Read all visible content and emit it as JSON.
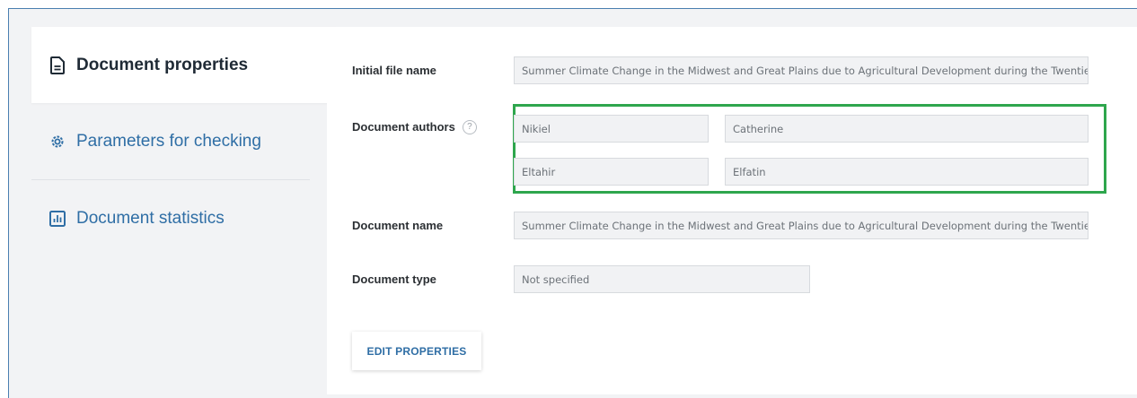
{
  "sidebar": {
    "items": [
      {
        "label": "Document properties",
        "icon": "document-icon",
        "active": true
      },
      {
        "label": "Parameters for checking",
        "icon": "gear-icon",
        "active": false
      },
      {
        "label": "Document statistics",
        "icon": "bar-chart-icon",
        "active": false
      }
    ]
  },
  "properties": {
    "initial_file_name": {
      "label": "Initial file name",
      "value": "Summer Climate Change in the Midwest and Great Plains due to Agricultural Development during the Twentieth C"
    },
    "authors": {
      "label": "Document authors",
      "help": "?",
      "list": [
        {
          "last": "Nikiel",
          "first": "Catherine"
        },
        {
          "last": "Eltahir",
          "first": "Elfatin"
        }
      ]
    },
    "document_name": {
      "label": "Document name",
      "value": "Summer Climate Change in the Midwest and Great Plains due to Agricultural Development during the Twentieth C"
    },
    "document_type": {
      "label": "Document type",
      "value": "Not specified"
    }
  },
  "actions": {
    "edit_label": "EDIT PROPERTIES"
  },
  "colors": {
    "accent": "#2f6ea5",
    "highlight": "#2ea64d"
  }
}
